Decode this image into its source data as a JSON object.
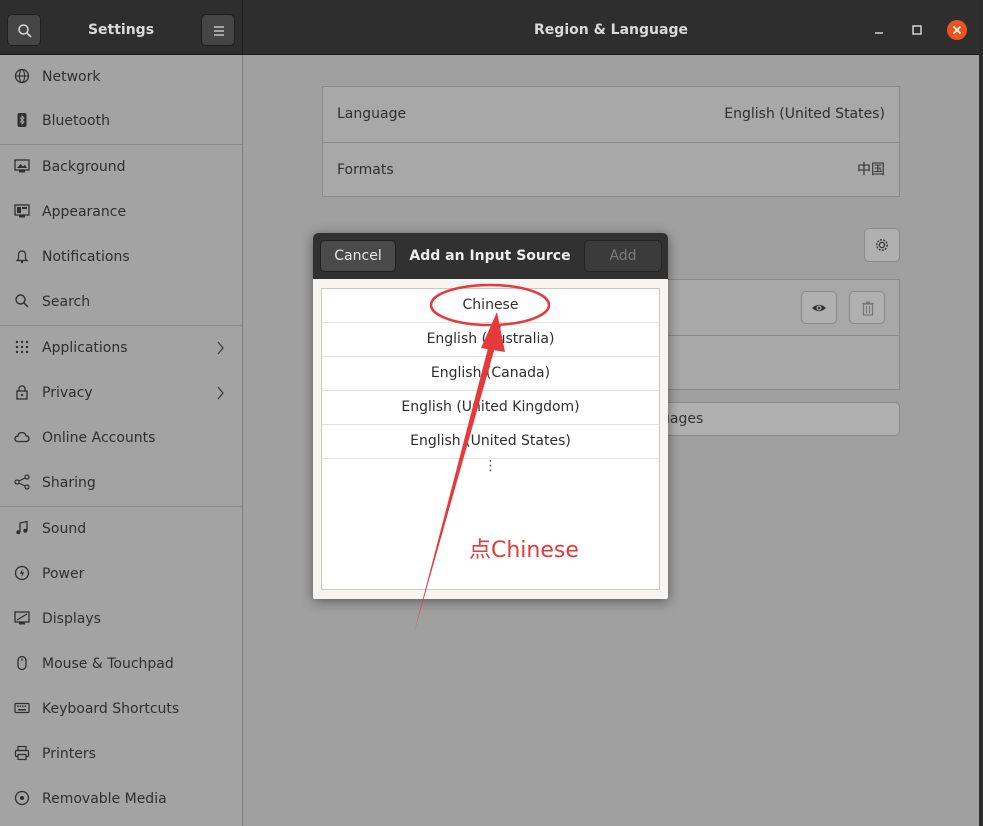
{
  "header": {
    "search_icon": "search-icon",
    "app_title": "Settings",
    "menu_icon": "menu-icon",
    "panel_title": "Region & Language"
  },
  "sidebar": {
    "items": [
      {
        "label": "Network",
        "icon": "network-icon"
      },
      {
        "label": "Bluetooth",
        "icon": "bluetooth-icon"
      },
      {
        "label": "Background",
        "icon": "background-icon"
      },
      {
        "label": "Appearance",
        "icon": "appearance-icon"
      },
      {
        "label": "Notifications",
        "icon": "bell-icon"
      },
      {
        "label": "Search",
        "icon": "search-icon"
      },
      {
        "label": "Applications",
        "icon": "grid-icon",
        "chevron": true
      },
      {
        "label": "Privacy",
        "icon": "lock-icon",
        "chevron": true
      },
      {
        "label": "Online Accounts",
        "icon": "cloud-icon"
      },
      {
        "label": "Sharing",
        "icon": "share-icon"
      },
      {
        "label": "Sound",
        "icon": "music-note-icon"
      },
      {
        "label": "Power",
        "icon": "power-icon"
      },
      {
        "label": "Displays",
        "icon": "display-icon"
      },
      {
        "label": "Mouse & Touchpad",
        "icon": "mouse-icon"
      },
      {
        "label": "Keyboard Shortcuts",
        "icon": "keyboard-icon"
      },
      {
        "label": "Printers",
        "icon": "printer-icon"
      },
      {
        "label": "Removable Media",
        "icon": "removable-media-icon"
      }
    ]
  },
  "region": {
    "language_label": "Language",
    "language_value": "English (United States)",
    "formats_label": "Formats",
    "formats_value": "中国",
    "manage_partial": "uages"
  },
  "dialog": {
    "cancel_label": "Cancel",
    "title": "Add an Input Source",
    "add_label": "Add",
    "items": [
      "Chinese",
      "English (Australia)",
      "English (Canada)",
      "English (United Kingdom)",
      "English (United States)"
    ],
    "more": "⋮"
  },
  "annotation": {
    "text": "点Chinese",
    "color": "#e63a3a"
  },
  "colors": {
    "accent": "#e95420",
    "annotation": "#e63a3a"
  }
}
